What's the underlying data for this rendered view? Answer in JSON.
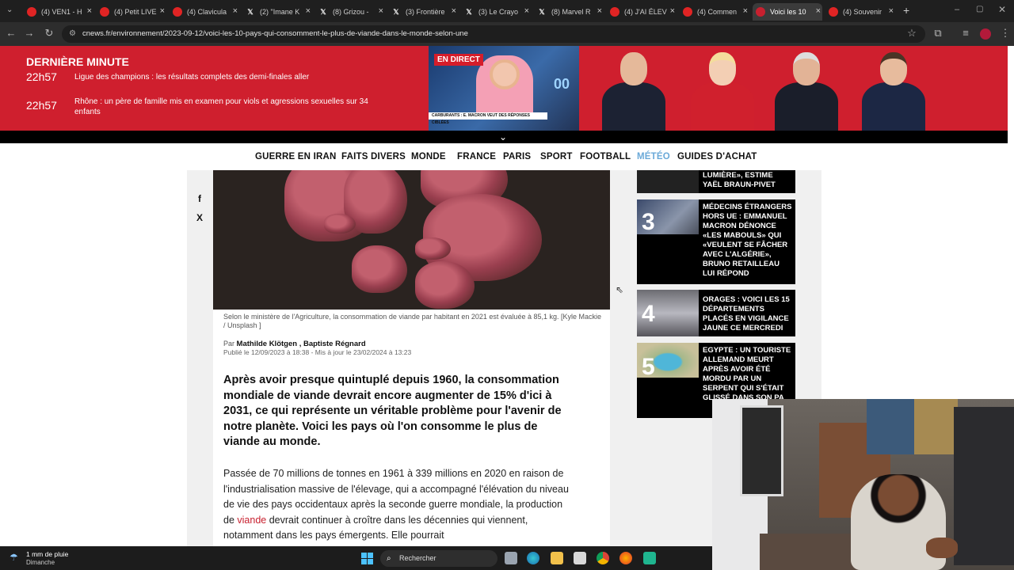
{
  "browser": {
    "tabs": [
      {
        "label": "(4) VEN1 - H",
        "icon": "youtube-icon"
      },
      {
        "label": "(4) Petit LIVE",
        "icon": "youtube-icon"
      },
      {
        "label": "(4) Clavicula",
        "icon": "youtube-icon"
      },
      {
        "label": "(2) \"Imane K",
        "icon": "x-icon"
      },
      {
        "label": "(8) Grizou - ",
        "icon": "x-icon"
      },
      {
        "label": "(3) Frontière",
        "icon": "x-icon"
      },
      {
        "label": "(3) Le Crayo",
        "icon": "x-icon"
      },
      {
        "label": "(8) Marvel R",
        "icon": "x-icon"
      },
      {
        "label": "(4) J'AI ÉLEV",
        "icon": "youtube-icon"
      },
      {
        "label": "(4) Commen",
        "icon": "youtube-icon"
      },
      {
        "label": "Voici les 10 ",
        "icon": "cnews-icon"
      },
      {
        "label": "(4) Souvenir",
        "icon": "youtube-icon"
      }
    ],
    "new_tab_symbol": "+",
    "url": "cnews.fr/environnement/2023-09-12/voici-les-10-pays-qui-consomment-le-plus-de-viande-dans-le-monde-selon-une"
  },
  "banner": {
    "title": "DERNIÈRE MINUTE",
    "items": [
      {
        "time": "22h57",
        "text": "Ligue des champions : les résultats complets des demi-finales aller"
      },
      {
        "time": "22h57",
        "text": "Rhône : un père de famille mis en examen pour viols et agressions sexuelles sur 34 enfants"
      }
    ],
    "live_badge": "EN DIRECT",
    "live_ticker": "CARBURANTS : E. MACRON VEUT DES RÉPONSES CIBLÉES",
    "live_digits": "00"
  },
  "site_nav": [
    "GUERRE EN IRAN",
    "FAITS DIVERS",
    "MONDE",
    "FRANCE",
    "PARIS",
    "SPORT",
    "FOOTBALL",
    "MÉTÉO",
    "GUIDES D'ACHAT"
  ],
  "article": {
    "share_facebook": "f",
    "share_x": "X",
    "caption": "Selon le ministère de l'Agriculture, la consommation de viande par habitant en 2021 est évaluée à 85,1 kg. [Kyle Mackie / Unsplash ]",
    "byline_prefix": "Par",
    "authors": "Mathilde Klötgen , Baptiste Régnard",
    "dates": "Publié le 12/09/2023 à 18:38 - Mis à jour le 23/02/2024 à 13:23",
    "lead": "Après avoir presque quintuplé depuis 1960, la consommation mondiale de viande devrait encore augmenter de 15% d'ici à 2031, ce qui représente un véritable problème pour l'avenir de notre planète. Voici les pays où l'on consomme le plus de viande au monde.",
    "body_part1": "Passée de 70 millions de tonnes en 1961 à 339 millions en 2020 en raison de l'industrialisation massive de l'élevage, qui a accompagné l'élévation du niveau de vie des pays occidentaux après la seconde guerre mondiale, la production de ",
    "body_link": "viande",
    "body_part2": " devrait continuer à croître dans les décennies qui viennent, notamment dans les pays émergents. Elle pourrait"
  },
  "sidebar": [
    {
      "number": "",
      "text": "LUMIÈRE», ESTIME YAËL BRAUN-PIVET"
    },
    {
      "number": "3",
      "text": "MÉDECINS ÉTRANGERS HORS UE : EMMANUEL MACRON DÉNONCE «LES MABOULS» QUI «VEULENT SE FÂCHER AVEC L'ALGÉRIE», BRUNO RETAILLEAU LUI RÉPOND"
    },
    {
      "number": "4",
      "text": "ORAGES : VOICI LES 15 DÉPARTEMENTS PLACÉS EN VIGILANCE JAUNE CE MERCREDI"
    },
    {
      "number": "5",
      "text": "EGYPTE : UN TOURISTE ALLEMAND MEURT APRÈS AVOIR ÉTÉ MORDU PAR UN SERPENT QUI S'ÉTAIT GLISSÉ DANS SON PA"
    }
  ],
  "taskbar": {
    "weather_value": "1 mm de pluie",
    "weather_day": "Dimanche",
    "search_placeholder": "Rechercher"
  },
  "colors": {
    "brand_red": "#cf1f2e",
    "meteo_blue": "#6aa9d8",
    "link_red": "#c8202f"
  }
}
